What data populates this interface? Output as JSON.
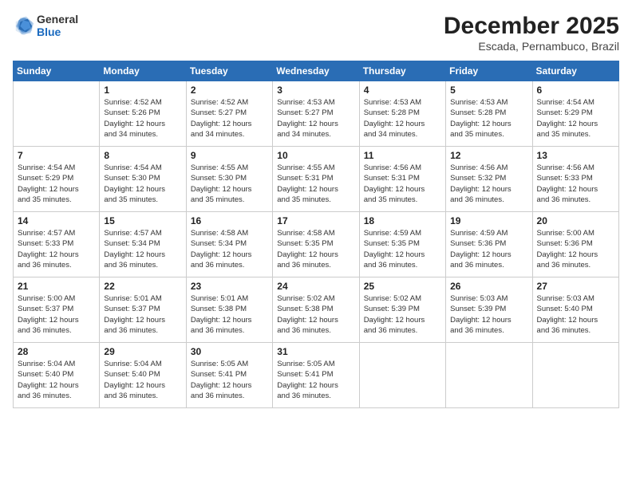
{
  "header": {
    "logo_line1": "General",
    "logo_line2": "Blue",
    "month_title": "December 2025",
    "location": "Escada, Pernambuco, Brazil"
  },
  "days_of_week": [
    "Sunday",
    "Monday",
    "Tuesday",
    "Wednesday",
    "Thursday",
    "Friday",
    "Saturday"
  ],
  "weeks": [
    [
      {
        "day": "",
        "info": ""
      },
      {
        "day": "1",
        "info": "Sunrise: 4:52 AM\nSunset: 5:26 PM\nDaylight: 12 hours\nand 34 minutes."
      },
      {
        "day": "2",
        "info": "Sunrise: 4:52 AM\nSunset: 5:27 PM\nDaylight: 12 hours\nand 34 minutes."
      },
      {
        "day": "3",
        "info": "Sunrise: 4:53 AM\nSunset: 5:27 PM\nDaylight: 12 hours\nand 34 minutes."
      },
      {
        "day": "4",
        "info": "Sunrise: 4:53 AM\nSunset: 5:28 PM\nDaylight: 12 hours\nand 34 minutes."
      },
      {
        "day": "5",
        "info": "Sunrise: 4:53 AM\nSunset: 5:28 PM\nDaylight: 12 hours\nand 35 minutes."
      },
      {
        "day": "6",
        "info": "Sunrise: 4:54 AM\nSunset: 5:29 PM\nDaylight: 12 hours\nand 35 minutes."
      }
    ],
    [
      {
        "day": "7",
        "info": "Sunrise: 4:54 AM\nSunset: 5:29 PM\nDaylight: 12 hours\nand 35 minutes."
      },
      {
        "day": "8",
        "info": "Sunrise: 4:54 AM\nSunset: 5:30 PM\nDaylight: 12 hours\nand 35 minutes."
      },
      {
        "day": "9",
        "info": "Sunrise: 4:55 AM\nSunset: 5:30 PM\nDaylight: 12 hours\nand 35 minutes."
      },
      {
        "day": "10",
        "info": "Sunrise: 4:55 AM\nSunset: 5:31 PM\nDaylight: 12 hours\nand 35 minutes."
      },
      {
        "day": "11",
        "info": "Sunrise: 4:56 AM\nSunset: 5:31 PM\nDaylight: 12 hours\nand 35 minutes."
      },
      {
        "day": "12",
        "info": "Sunrise: 4:56 AM\nSunset: 5:32 PM\nDaylight: 12 hours\nand 36 minutes."
      },
      {
        "day": "13",
        "info": "Sunrise: 4:56 AM\nSunset: 5:33 PM\nDaylight: 12 hours\nand 36 minutes."
      }
    ],
    [
      {
        "day": "14",
        "info": "Sunrise: 4:57 AM\nSunset: 5:33 PM\nDaylight: 12 hours\nand 36 minutes."
      },
      {
        "day": "15",
        "info": "Sunrise: 4:57 AM\nSunset: 5:34 PM\nDaylight: 12 hours\nand 36 minutes."
      },
      {
        "day": "16",
        "info": "Sunrise: 4:58 AM\nSunset: 5:34 PM\nDaylight: 12 hours\nand 36 minutes."
      },
      {
        "day": "17",
        "info": "Sunrise: 4:58 AM\nSunset: 5:35 PM\nDaylight: 12 hours\nand 36 minutes."
      },
      {
        "day": "18",
        "info": "Sunrise: 4:59 AM\nSunset: 5:35 PM\nDaylight: 12 hours\nand 36 minutes."
      },
      {
        "day": "19",
        "info": "Sunrise: 4:59 AM\nSunset: 5:36 PM\nDaylight: 12 hours\nand 36 minutes."
      },
      {
        "day": "20",
        "info": "Sunrise: 5:00 AM\nSunset: 5:36 PM\nDaylight: 12 hours\nand 36 minutes."
      }
    ],
    [
      {
        "day": "21",
        "info": "Sunrise: 5:00 AM\nSunset: 5:37 PM\nDaylight: 12 hours\nand 36 minutes."
      },
      {
        "day": "22",
        "info": "Sunrise: 5:01 AM\nSunset: 5:37 PM\nDaylight: 12 hours\nand 36 minutes."
      },
      {
        "day": "23",
        "info": "Sunrise: 5:01 AM\nSunset: 5:38 PM\nDaylight: 12 hours\nand 36 minutes."
      },
      {
        "day": "24",
        "info": "Sunrise: 5:02 AM\nSunset: 5:38 PM\nDaylight: 12 hours\nand 36 minutes."
      },
      {
        "day": "25",
        "info": "Sunrise: 5:02 AM\nSunset: 5:39 PM\nDaylight: 12 hours\nand 36 minutes."
      },
      {
        "day": "26",
        "info": "Sunrise: 5:03 AM\nSunset: 5:39 PM\nDaylight: 12 hours\nand 36 minutes."
      },
      {
        "day": "27",
        "info": "Sunrise: 5:03 AM\nSunset: 5:40 PM\nDaylight: 12 hours\nand 36 minutes."
      }
    ],
    [
      {
        "day": "28",
        "info": "Sunrise: 5:04 AM\nSunset: 5:40 PM\nDaylight: 12 hours\nand 36 minutes."
      },
      {
        "day": "29",
        "info": "Sunrise: 5:04 AM\nSunset: 5:40 PM\nDaylight: 12 hours\nand 36 minutes."
      },
      {
        "day": "30",
        "info": "Sunrise: 5:05 AM\nSunset: 5:41 PM\nDaylight: 12 hours\nand 36 minutes."
      },
      {
        "day": "31",
        "info": "Sunrise: 5:05 AM\nSunset: 5:41 PM\nDaylight: 12 hours\nand 36 minutes."
      },
      {
        "day": "",
        "info": ""
      },
      {
        "day": "",
        "info": ""
      },
      {
        "day": "",
        "info": ""
      }
    ]
  ]
}
